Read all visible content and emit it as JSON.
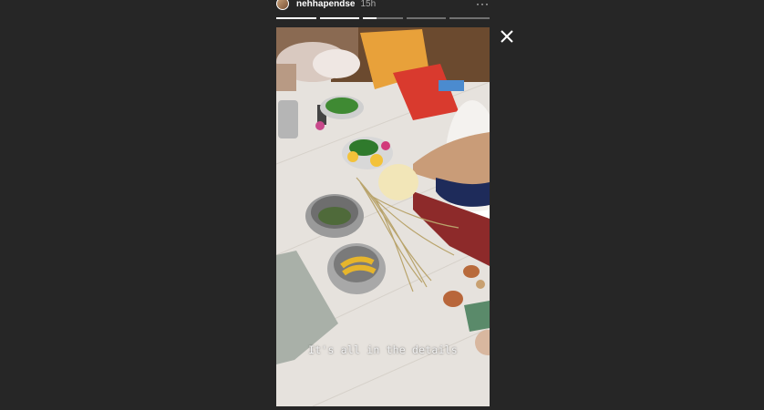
{
  "story": {
    "username": "nehhapendse",
    "timestamp": "15h",
    "more_label": "···",
    "caption": "It's all in the details",
    "progress": [
      1,
      1,
      0.35,
      0,
      0
    ]
  },
  "icons": {
    "close": "close-icon",
    "avatar": "avatar"
  },
  "colors": {
    "background": "#262626",
    "progress_fill": "#ffffff",
    "progress_track": "rgba(255,255,255,0.35)"
  }
}
